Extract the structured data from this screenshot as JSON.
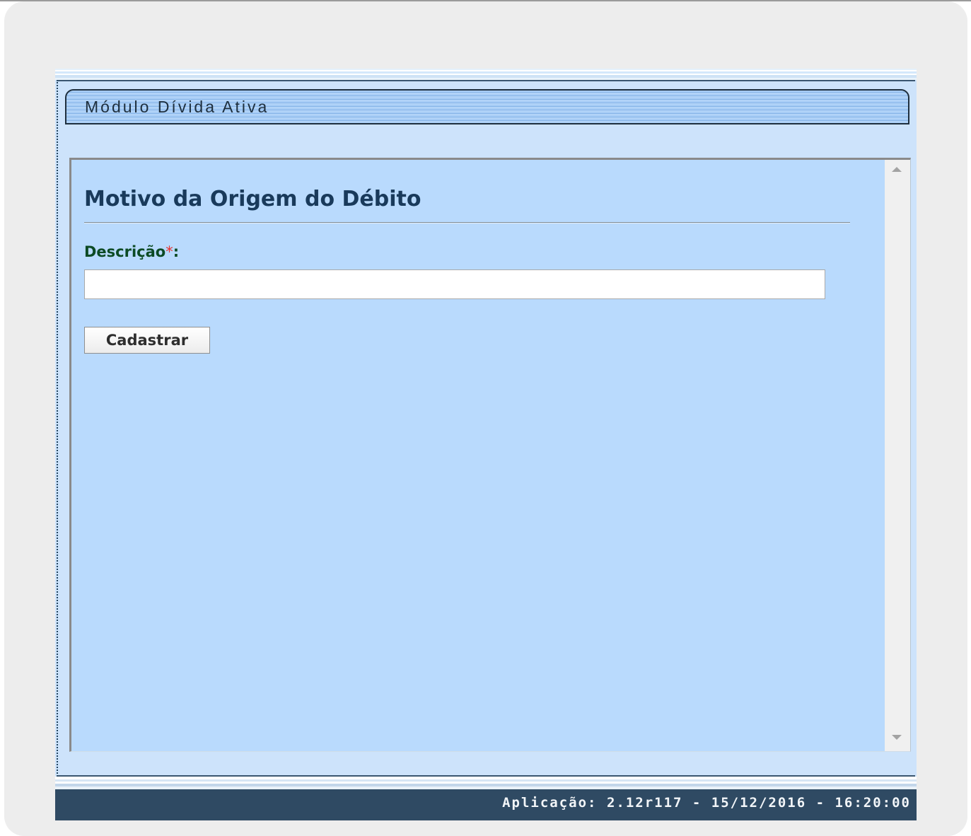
{
  "module": {
    "title": "Módulo Dívida Ativa"
  },
  "form": {
    "title": "Motivo da Origem do Débito",
    "description_label": "Descrição",
    "required_marker": "*",
    "label_suffix": ":",
    "description_value": "",
    "submit_label": "Cadastrar"
  },
  "footer": {
    "version_text": "Aplicação: 2.12r117 - 15/12/2016 - 16:20:00"
  },
  "colors": {
    "frame_background": "#cde3fb",
    "content_background": "#b9dafd",
    "footer_background": "#2f4a63",
    "title_color": "#193a5b",
    "label_color": "#0c4a24",
    "required_color": "#e8322e"
  },
  "icons": {
    "scroll_up": "triangle-up",
    "scroll_down": "triangle-down"
  }
}
